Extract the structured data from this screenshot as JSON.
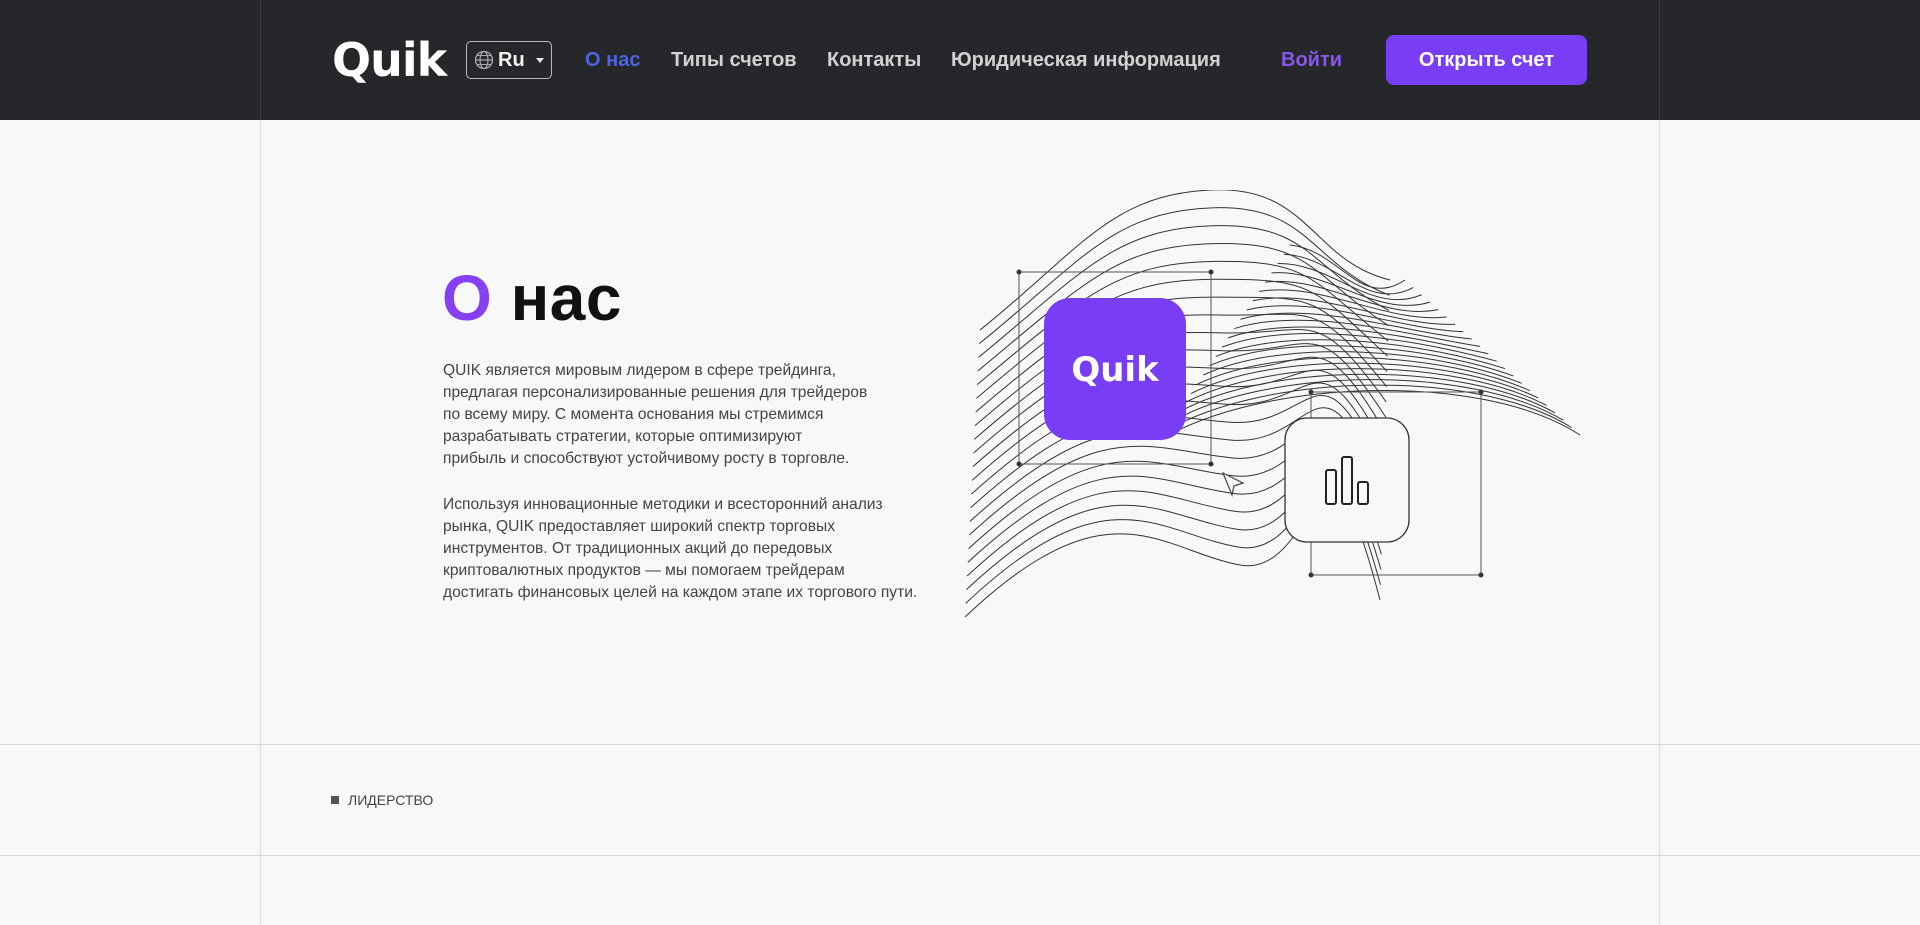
{
  "brand": {
    "logo_text": "Quik"
  },
  "language": {
    "code": "Ru"
  },
  "nav": {
    "items": [
      {
        "label": "О нас",
        "active": true
      },
      {
        "label": "Типы счетов",
        "active": false
      },
      {
        "label": "Контакты",
        "active": false
      },
      {
        "label": "Юридическая информация",
        "active": false
      }
    ]
  },
  "auth": {
    "login_label": "Войти",
    "open_account_label": "Открыть счет"
  },
  "hero": {
    "title_accent": "О",
    "title_rest": "нас",
    "paragraph1_lines": [
      "QUIK является мировым лидером в сфере трейдинга,",
      "предлагая персонализированные решения для трейдеров",
      "по всему миру. С момента основания мы стремимся",
      "разрабатывать стратегии, которые оптимизируют",
      "прибыль и способствуют устойчивому росту в торговле."
    ],
    "paragraph2_lines": [
      "Используя инновационные методики и всесторонний анализ",
      "рынка, QUIK предоставляет широкий спектр торговых",
      "инструментов. От традиционных акций до передовых",
      "криптовалютных продуктов — мы помогаем трейдерам",
      "достигать финансовых целей на каждом этапе их торгового пути."
    ],
    "illustration": {
      "app_tile_text": "Quik",
      "icons": [
        "chart-bars-icon",
        "cursor-icon"
      ]
    }
  },
  "section": {
    "label": "ЛИДЕРСТВО"
  },
  "colors": {
    "header_bg": "#26272b",
    "accent": "#7a3df6",
    "nav_active": "#4f63e4",
    "page_bg": "#f8f8f8"
  }
}
